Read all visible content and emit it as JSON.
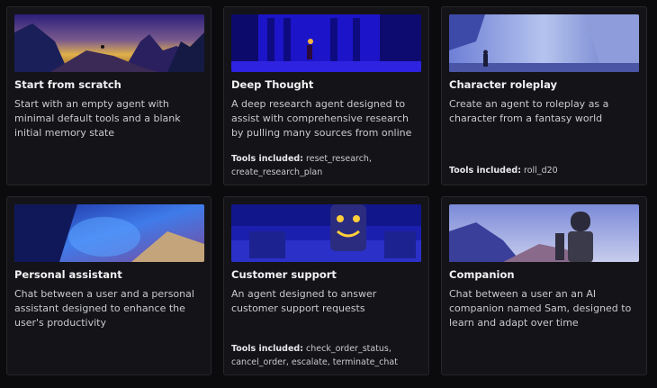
{
  "cards": [
    {
      "title": "Start from scratch",
      "description": "Start with an empty agent with minimal default tools and a blank initial memory state",
      "tools_label": "",
      "tools": ""
    },
    {
      "title": "Deep Thought",
      "description": "A deep research agent designed to assist with comprehensive research by pulling many sources from online",
      "tools_label": "Tools included:",
      "tools": "reset_research, create_research_plan"
    },
    {
      "title": "Character roleplay",
      "description": "Create an agent to roleplay as a character from a fantasy world",
      "tools_label": "Tools included:",
      "tools": "roll_d20"
    },
    {
      "title": "Personal assistant",
      "description": "Chat between a user and a personal assistant designed to enhance the user's productivity",
      "tools_label": "",
      "tools": ""
    },
    {
      "title": "Customer support",
      "description": "An agent designed to answer customer support requests",
      "tools_label": "Tools included:",
      "tools": "check_order_status, cancel_order, escalate, terminate_chat"
    },
    {
      "title": "Companion",
      "description": "Chat between a user an an AI companion named Sam, designed to learn and adapt over time",
      "tools_label": "",
      "tools": ""
    }
  ],
  "colors": {
    "background": "#0b0b0e",
    "card": "#141418",
    "border": "#26262b",
    "accent_blue": "#2a2ae8"
  }
}
